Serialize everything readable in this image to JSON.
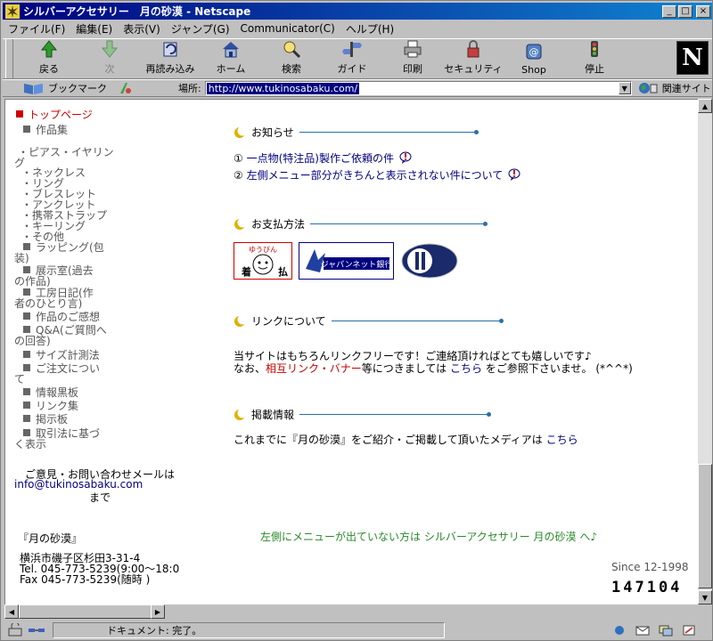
{
  "window": {
    "title": "シルバーアクセサリー　月の砂漠 - Netscape",
    "buttons": {
      "minimize": "_",
      "maximize": "□",
      "close": "×"
    }
  },
  "menu": [
    "ファイル(F)",
    "編集(E)",
    "表示(V)",
    "ジャンプ(G)",
    "Communicator(C)",
    "ヘルプ(H)"
  ],
  "toolbar": {
    "buttons": [
      {
        "label": "戻る",
        "icon": "back-arrow-icon",
        "disabled": false
      },
      {
        "label": "次",
        "icon": "forward-arrow-icon",
        "disabled": true
      },
      {
        "label": "再読み込み",
        "icon": "reload-icon",
        "disabled": false
      },
      {
        "label": "ホーム",
        "icon": "home-icon",
        "disabled": false
      },
      {
        "label": "検索",
        "icon": "search-icon",
        "disabled": false
      },
      {
        "label": "ガイド",
        "icon": "guide-icon",
        "disabled": false
      },
      {
        "label": "印刷",
        "icon": "print-icon",
        "disabled": false
      },
      {
        "label": "セキュリティ",
        "icon": "security-lock-icon",
        "disabled": false
      },
      {
        "label": "Shop",
        "icon": "shop-icon",
        "disabled": false
      },
      {
        "label": "停止",
        "icon": "stop-icon",
        "disabled": false
      }
    ],
    "logo": "N"
  },
  "location": {
    "bookmark_label": "ブックマーク",
    "label": "場所:",
    "url": "http://www.tukinosabaku.com/",
    "related_label": "関連サイト"
  },
  "left_nav": {
    "items": [
      {
        "label": "トップページ",
        "current": true,
        "square": true
      },
      {
        "label": "作品集",
        "current": false,
        "square": true
      },
      {
        "label": "・ピアス・イヤリン",
        "current": false,
        "square": false
      },
      {
        "label": "グ",
        "current": false,
        "square": false
      },
      {
        "label": "・ネックレス",
        "current": false,
        "square": false
      },
      {
        "label": "・リング",
        "current": false,
        "square": false
      },
      {
        "label": "・ブレスレット",
        "current": false,
        "square": false
      },
      {
        "label": "・アンクレット",
        "current": false,
        "square": false
      },
      {
        "label": "・携帯ストラップ",
        "current": false,
        "square": false
      },
      {
        "label": "・キーリング",
        "current": false,
        "square": false
      },
      {
        "label": "・その他",
        "current": false,
        "square": false
      },
      {
        "label": "ラッピング(包",
        "current": false,
        "square": true
      },
      {
        "label": "装)",
        "current": false,
        "square": false
      },
      {
        "label": "展示室(過去",
        "current": false,
        "square": true
      },
      {
        "label": "の作品)",
        "current": false,
        "square": false
      },
      {
        "label": "工房日記(作",
        "current": false,
        "square": true
      },
      {
        "label": "者のひとり言)",
        "current": false,
        "square": false
      },
      {
        "label": "作品のご感想",
        "current": false,
        "square": true
      },
      {
        "label": "Q&A(ご質問へ",
        "current": false,
        "square": true
      },
      {
        "label": "の回答)",
        "current": false,
        "square": false
      },
      {
        "label": "サイズ計測法",
        "current": false,
        "square": true
      },
      {
        "label": "ご注文につい",
        "current": false,
        "square": true
      },
      {
        "label": "て",
        "current": false,
        "square": false
      },
      {
        "label": "情報黒板",
        "current": false,
        "square": true
      },
      {
        "label": "リンク集",
        "current": false,
        "square": true
      },
      {
        "label": "掲示板",
        "current": false,
        "square": true
      },
      {
        "label": "取引法に基づ",
        "current": false,
        "square": true
      },
      {
        "label": "く表示",
        "current": false,
        "square": false
      }
    ],
    "contact_line1": "ご意見・お問い合わせメールは",
    "contact_email": "info@tukinosabaku.com",
    "contact_line3": "まで",
    "shop_name": "『月の砂漠』",
    "address": "横浜市磯子区杉田3-31-4",
    "tel": "Tel. 045-773-5239(9:00〜18:0",
    "fax": "Fax 045-773-5239(随時 )"
  },
  "main": {
    "news_title": "お知らせ",
    "news_items": [
      {
        "num": "①",
        "text": "一点物(特注品)製作ご依頼の件"
      },
      {
        "num": "②",
        "text": "左側メニュー部分がきちんと表示されない件について"
      }
    ],
    "payment_title": "お支払方法",
    "payment_logos": {
      "cod_top": "ゆうびん",
      "cod_left": "着",
      "cod_right": "払",
      "bank": "ジャパンネット銀行"
    },
    "link_title": "リンクについて",
    "link_line1": "当サイトはもちろんリンクフリーです！ご連絡頂ければとても嬉しいです♪",
    "link_line2_a": "なお、",
    "link_line2_red": "相互リンク・バナー",
    "link_line2_b": "等につきましては",
    "link_line2_link": "こちら",
    "link_line2_c": "をご参照下さいませ。 (*^^*)",
    "media_title": "掲載情報",
    "media_line": "これまでに『月の砂漠』をご紹介・ご掲載して頂いたメディアは",
    "media_link": "こちら",
    "menu_notice": "左側にメニューが出ていない方は シルバーアクセサリー 月の砂漠 へ♪",
    "since": "Since 12-1998",
    "counter": "147104"
  },
  "status": {
    "text": "ドキュメント: 完了。"
  }
}
